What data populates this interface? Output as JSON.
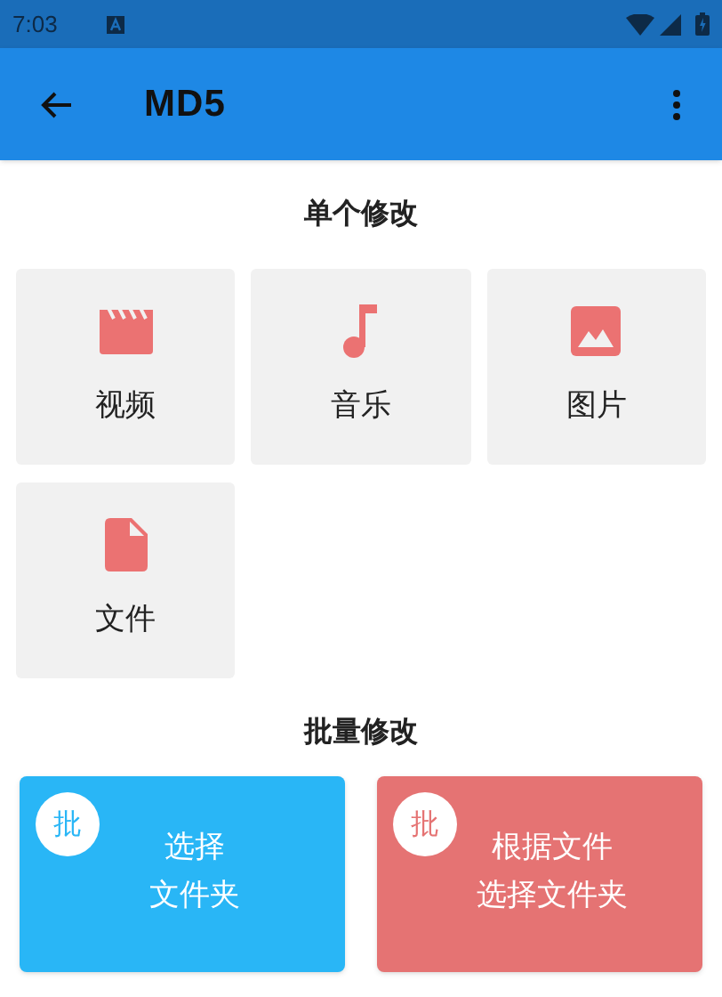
{
  "status_bar": {
    "time": "7:03"
  },
  "app_bar": {
    "title": "MD5"
  },
  "single_section": {
    "title": "单个修改",
    "tiles": [
      {
        "kind": "video",
        "label": "视频"
      },
      {
        "kind": "music",
        "label": "音乐"
      },
      {
        "kind": "image",
        "label": "图片"
      },
      {
        "kind": "file",
        "label": "文件"
      }
    ]
  },
  "batch_section": {
    "title": "批量修改",
    "cards": [
      {
        "badge": "批",
        "lines": [
          "选择",
          "文件夹"
        ],
        "color": "#29b6f6"
      },
      {
        "badge": "批",
        "lines": [
          "根据文件",
          "选择文件夹"
        ],
        "color": "#e57373"
      }
    ]
  }
}
